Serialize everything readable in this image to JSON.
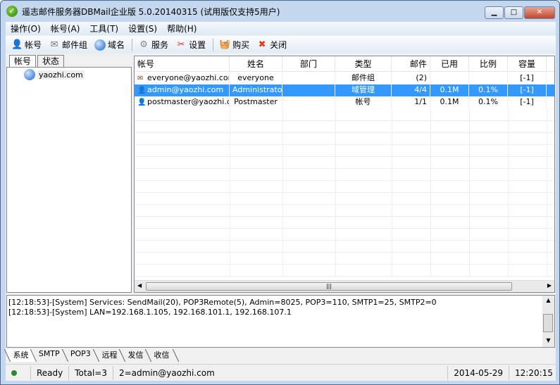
{
  "window": {
    "title": "遥志邮件服务器DBMail企业版 5.0.20140315 (试用版仅支持5用户)",
    "min": "▁",
    "max": "□",
    "close": "✕"
  },
  "menu": [
    "操作(O)",
    "帐号(A)",
    "工具(T)",
    "设置(S)",
    "帮助(H)"
  ],
  "toolbar": [
    {
      "label": "帐号",
      "icon": "user-icon"
    },
    {
      "label": "邮件组",
      "icon": "mail-group-icon"
    },
    {
      "label": "域名",
      "icon": "globe-icon"
    },
    {
      "label": "服务",
      "icon": "gear-icon"
    },
    {
      "label": "设置",
      "icon": "tools-icon"
    },
    {
      "label": "购买",
      "icon": "basket-icon"
    },
    {
      "label": "关闭",
      "icon": "close-icon"
    }
  ],
  "left_tabs": [
    "帐号",
    "状态"
  ],
  "tree": {
    "domain": "yaozhi.com"
  },
  "columns": [
    "帐号",
    "姓名",
    "部门",
    "类型",
    "邮件",
    "已用",
    "比例",
    "容量"
  ],
  "rows": [
    {
      "account": "everyone@yaozhi.com",
      "name": "everyone",
      "dept": "",
      "type": "邮件组",
      "mail": "(2)",
      "used": "",
      "ratio": "",
      "quota": "[-1]",
      "icon": "mail-group-icon"
    },
    {
      "account": "admin@yaozhi.com",
      "name": "Administrator",
      "dept": "",
      "type": "域管理",
      "mail": "4/4",
      "used": "0.1M",
      "ratio": "0.1%",
      "quota": "[-1]",
      "icon": "admin-user-icon"
    },
    {
      "account": "postmaster@yaozhi.c...",
      "name": "Postmaster",
      "dept": "",
      "type": "帐号",
      "mail": "1/1",
      "used": "0.1M",
      "ratio": "0.1%",
      "quota": "[-1]",
      "icon": "user-icon"
    }
  ],
  "log": [
    "[12:18:53]-[System] Services: SendMail(20), POP3Remote(5), Admin=8025, POP3=110, SMTP1=25, SMTP2=0",
    "[12:18:53]-[System] LAN=192.168.1.105, 192.168.101.1, 192.168.107.1"
  ],
  "bottom_tabs": [
    "系统",
    "SMTP",
    "POP3",
    "远程",
    "发信",
    "收信"
  ],
  "status": {
    "state": "Ready",
    "total": "Total=3",
    "selected": "2=admin@yaozhi.com",
    "date": "2014-05-29",
    "time": "12:20:15"
  }
}
